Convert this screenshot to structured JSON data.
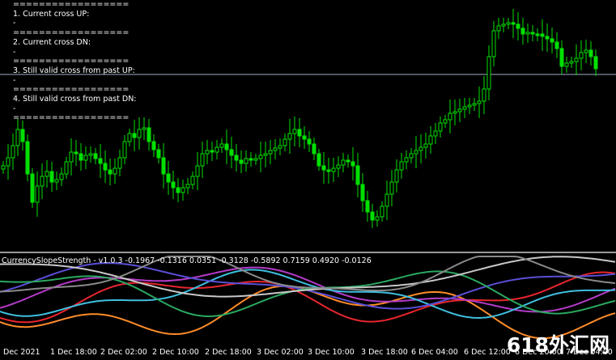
{
  "overlay": {
    "lines": [
      "==================",
      "1. Current cross UP:",
      "-",
      "==================",
      "2. Current cross DN:",
      "-",
      "==================",
      "3. Still valid cross from past UP:",
      "-",
      "==================",
      "4. Still valid cross from past DN:",
      "-",
      "=================="
    ]
  },
  "indicator": {
    "title": "CurrencySlopeStrength - v1.0.3 -0.1967 -0.1316 0.0351 -0.3128 -0.5892 0.7159 0.4920 -0.0126",
    "series_colors": [
      "#ff8c2a",
      "#e8252d",
      "#b43bc8",
      "#3fbfe0",
      "#5a4fd6",
      "#2aa860",
      "#c8c8c8",
      "#8a8a8a"
    ]
  },
  "time_axis": {
    "labels": [
      "Dec 2021",
      "1 Dec 18:00",
      "2 Dec 02:00",
      "2 Dec 10:00",
      "2 Dec 18:00",
      "3 Dec 02:00",
      "3 Dec 10:00",
      "3 Dec 18:00",
      "6 Dec 04:00",
      "6 Dec 12:00",
      "6 Dec 20:00",
      "7 Dec 04:00"
    ]
  },
  "watermark": "618外汇网",
  "colors": {
    "background": "#000000",
    "candle": "#00e000",
    "hline": "#9fb0c8",
    "text": "#ffffff"
  }
}
